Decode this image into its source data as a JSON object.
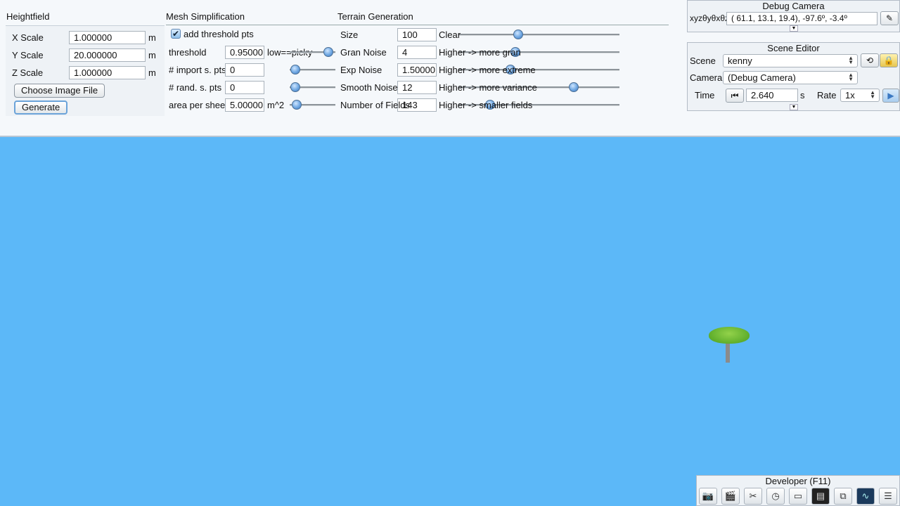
{
  "heightfield": {
    "title": "Heightfield",
    "x_scale": {
      "label": "X Scale",
      "value": "1.000000",
      "unit": "m"
    },
    "y_scale": {
      "label": "Y Scale",
      "value": "20.000000",
      "unit": "m"
    },
    "z_scale": {
      "label": "Z Scale",
      "value": "1.000000",
      "unit": "m"
    },
    "choose_button": "Choose Image File",
    "generate_button": "Generate"
  },
  "mesh": {
    "title": "Mesh Simplification",
    "add_threshold_label": "add threshold pts",
    "add_threshold_checked": true,
    "threshold": {
      "label": "threshold",
      "value": "0.95000",
      "hint": "low==picky"
    },
    "import_pts": {
      "label": "# import s. pts",
      "value": "0"
    },
    "rand_pts": {
      "label": "# rand. s. pts",
      "value": "0"
    },
    "area": {
      "label": "area per sheep",
      "value": "5.00000",
      "unit": "m^2"
    }
  },
  "terrain": {
    "title": "Terrain Generation",
    "size": {
      "label": "Size",
      "value": "100",
      "hint": "Clear"
    },
    "gran_noise": {
      "label": "Gran Noise",
      "value": "4",
      "hint": "Higher -> more gran"
    },
    "exp_noise": {
      "label": "Exp Noise",
      "value": "1.50000",
      "hint": "Higher -> more extreme"
    },
    "smooth_noise": {
      "label": "Smooth Noise",
      "value": "12",
      "hint": "Higher -> more variance"
    },
    "num_fields": {
      "label": "Number of Fields",
      "value": "143",
      "hint": "Higher -> smaller fields"
    }
  },
  "debug_camera": {
    "title": "Debug Camera",
    "xyz_label": "xyzθyθxθz",
    "value": "( 61.1,  13.1,  19.4), -97.6º,  -3.4º"
  },
  "scene_editor": {
    "title": "Scene Editor",
    "scene_label": "Scene",
    "scene_value": "kenny",
    "camera_label": "Camera",
    "camera_value": "(Debug Camera)",
    "time_label": "Time",
    "time_value": "2.640",
    "time_unit": "s",
    "rate_label": "Rate",
    "rate_value": "1x"
  },
  "developer": {
    "title": "Developer (F11)",
    "icons": [
      "camera-icon",
      "clapper-icon",
      "tools-icon",
      "profiler-icon",
      "new-file-icon",
      "terminal-icon",
      "windows-icon",
      "monitor-icon",
      "document-icon"
    ]
  },
  "colors": {
    "sky": "#5cb8f8",
    "panel": "#f5f8fb",
    "slider_knob": "#6fa7e2"
  }
}
